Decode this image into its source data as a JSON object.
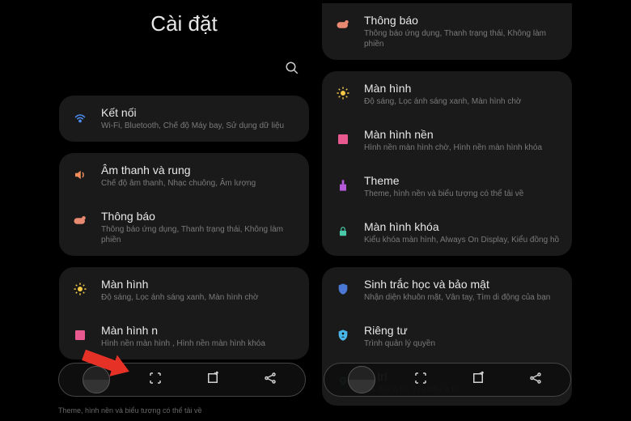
{
  "left": {
    "title": "Cài đặt",
    "truncated_text": "Theme, hình nền và biểu tượng có thể tải về",
    "groups": [
      [
        {
          "icon": "wifi",
          "color": "c-blue",
          "title": "Kết nối",
          "subtitle": "Wi-Fi, Bluetooth, Chế độ Máy bay, Sử dụng dữ liệu"
        }
      ],
      [
        {
          "icon": "sound",
          "color": "c-orange",
          "title": "Âm thanh và rung",
          "subtitle": "Chế độ âm thanh, Nhạc chuông, Âm lượng"
        },
        {
          "icon": "notif",
          "color": "c-peach",
          "title": "Thông báo",
          "subtitle": "Thông báo ứng dụng, Thanh trạng thái, Không làm phiền"
        }
      ],
      [
        {
          "icon": "display",
          "color": "c-yellow",
          "title": "Màn hình",
          "subtitle": "Độ sáng, Lọc ánh sáng xanh, Màn hình chờ"
        },
        {
          "icon": "wallpaper",
          "color": "c-pink",
          "title": "Màn hình n",
          "subtitle": "Hình nền màn hình          , Hình nền màn hình khóa"
        }
      ]
    ]
  },
  "right": {
    "groups": [
      [
        {
          "icon": "notif",
          "color": "c-peach",
          "title": "Thông báo",
          "subtitle": "Thông báo ứng dụng, Thanh trạng thái, Không làm phiền"
        }
      ],
      [
        {
          "icon": "display",
          "color": "c-yellow",
          "title": "Màn hình",
          "subtitle": "Độ sáng, Lọc ánh sáng xanh, Màn hình chờ"
        },
        {
          "icon": "wallpaper",
          "color": "c-pink",
          "title": "Màn hình nền",
          "subtitle": "Hình nền màn hình chờ, Hình nền màn hình khóa"
        },
        {
          "icon": "theme",
          "color": "c-purple",
          "title": "Theme",
          "subtitle": "Theme, hình nền và biểu tượng có thể tải về"
        },
        {
          "icon": "lock",
          "color": "c-teal",
          "title": "Màn hình khóa",
          "subtitle": "Kiểu khóa màn hình, Always On Display, Kiểu đồng hồ"
        }
      ],
      [
        {
          "icon": "biometric",
          "color": "c-blue2",
          "title": "Sinh trắc học và bảo mật",
          "subtitle": "Nhận diện khuôn mặt, Vân tay, Tìm di động của bạn"
        },
        {
          "icon": "privacy",
          "color": "c-cyan",
          "title": "Riêng tư",
          "subtitle": "Trình quản lý quyền"
        },
        {
          "icon": "location",
          "color": "c-green",
          "title": "Vị trí",
          "subtitle": "Cài đặt vị trí, Yêu cầu vị trí"
        }
      ]
    ]
  }
}
